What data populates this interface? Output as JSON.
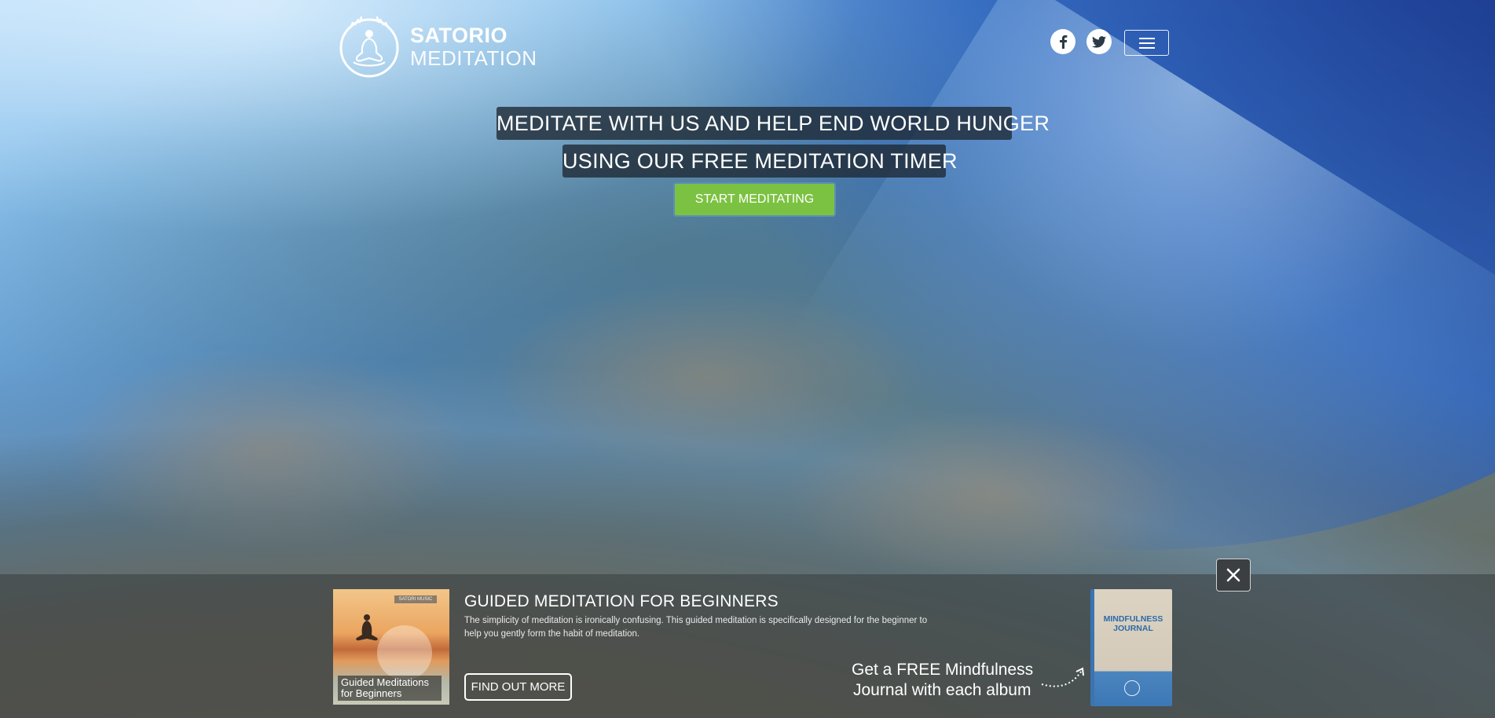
{
  "brand": {
    "line1": "SATORIO",
    "line2": "MEDITATION"
  },
  "header": {
    "social": [
      {
        "name": "facebook-icon",
        "glyph": "f"
      },
      {
        "name": "twitter-icon",
        "glyph": ""
      }
    ],
    "menu_label": "menu"
  },
  "hero": {
    "headline_1": "MEDITATE WITH US AND HELP END WORLD HUNGER",
    "headline_2": "USING OUR FREE MEDITATION TIMER",
    "cta_label": "START MEDITATING"
  },
  "promo": {
    "album_badge": "SATORI MUSIC",
    "album_caption": "Guided Meditations for Beginners",
    "title": "GUIDED MEDITATION FOR BEGINNERS",
    "description": "The simplicity of meditation is ironically confusing. This guided meditation is specifically designed for the beginner to help you gently form the habit of meditation.",
    "button_label": "FIND OUT MORE",
    "offer_line1": "Get a FREE Mindfulness",
    "offer_line2": "Journal with each album",
    "journal_title": "MINDFULNESS JOURNAL",
    "close_label": "✕"
  },
  "colors": {
    "cta_green": "#7cc242",
    "headline_bg": "#1e2832",
    "promo_bg": "#3c4244"
  }
}
